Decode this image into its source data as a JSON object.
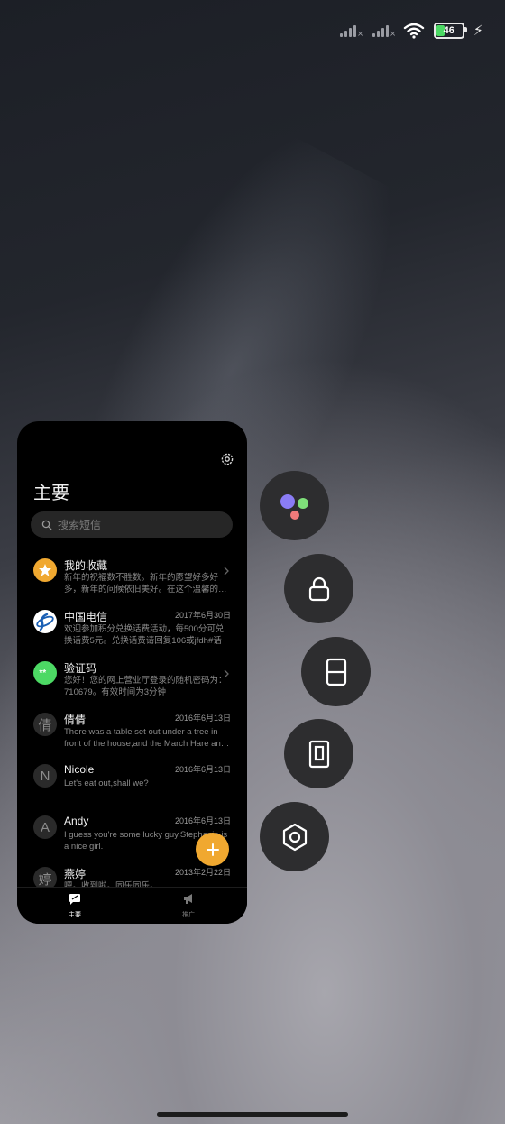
{
  "status_bar": {
    "battery_level": "46"
  },
  "window": {
    "title": "主要",
    "search_placeholder": "搜索短信",
    "messages": [
      {
        "name": "我的收藏",
        "date": "",
        "preview": "新年的祝福数不胜数。新年的愿望好多好多，新年的问候依旧美好。在这个温馨的…",
        "avatar": "star-icon",
        "avatar_color": "#f0a830"
      },
      {
        "name": "中国电信",
        "date": "2017年6月30日",
        "preview": "欢迎参加积分兑换话费活动，每500分可兑换话费5元。兑换话费请回复106或jfdh#话费…",
        "avatar": "china-telecom-logo",
        "avatar_color": "#ffffff"
      },
      {
        "name": "验证码",
        "date": "",
        "preview": "您好！您的网上营业厅登录的随机密码为：710679。有效时间为3分钟",
        "avatar": "verification-code-icon",
        "avatar_color": "#4cd964"
      },
      {
        "name": "倩倩",
        "date": "2016年6月13日",
        "preview": "There was a table set out under a tree in front of the house,and the March Hare an…",
        "avatar_char": "倩"
      },
      {
        "name": "Nicole",
        "date": "2016年6月13日",
        "preview": "Let's eat out,shall we?",
        "avatar_char": "N"
      },
      {
        "name": "Andy",
        "date": "2016年6月13日",
        "preview": "I guess you're some lucky guy,Stephanie is a nice girl.",
        "avatar_char": "A"
      },
      {
        "name": "燕婷",
        "date": "2013年2月22日",
        "preview": "嗯。收到啦。同乐同乐。",
        "avatar_char": "婷"
      }
    ],
    "nav": {
      "primary_label": "主要",
      "promo_label": "推广"
    }
  },
  "colors": {
    "accent": "#f0a830",
    "panel_bg": "#000000",
    "button_bg": "#2d2d2f"
  }
}
